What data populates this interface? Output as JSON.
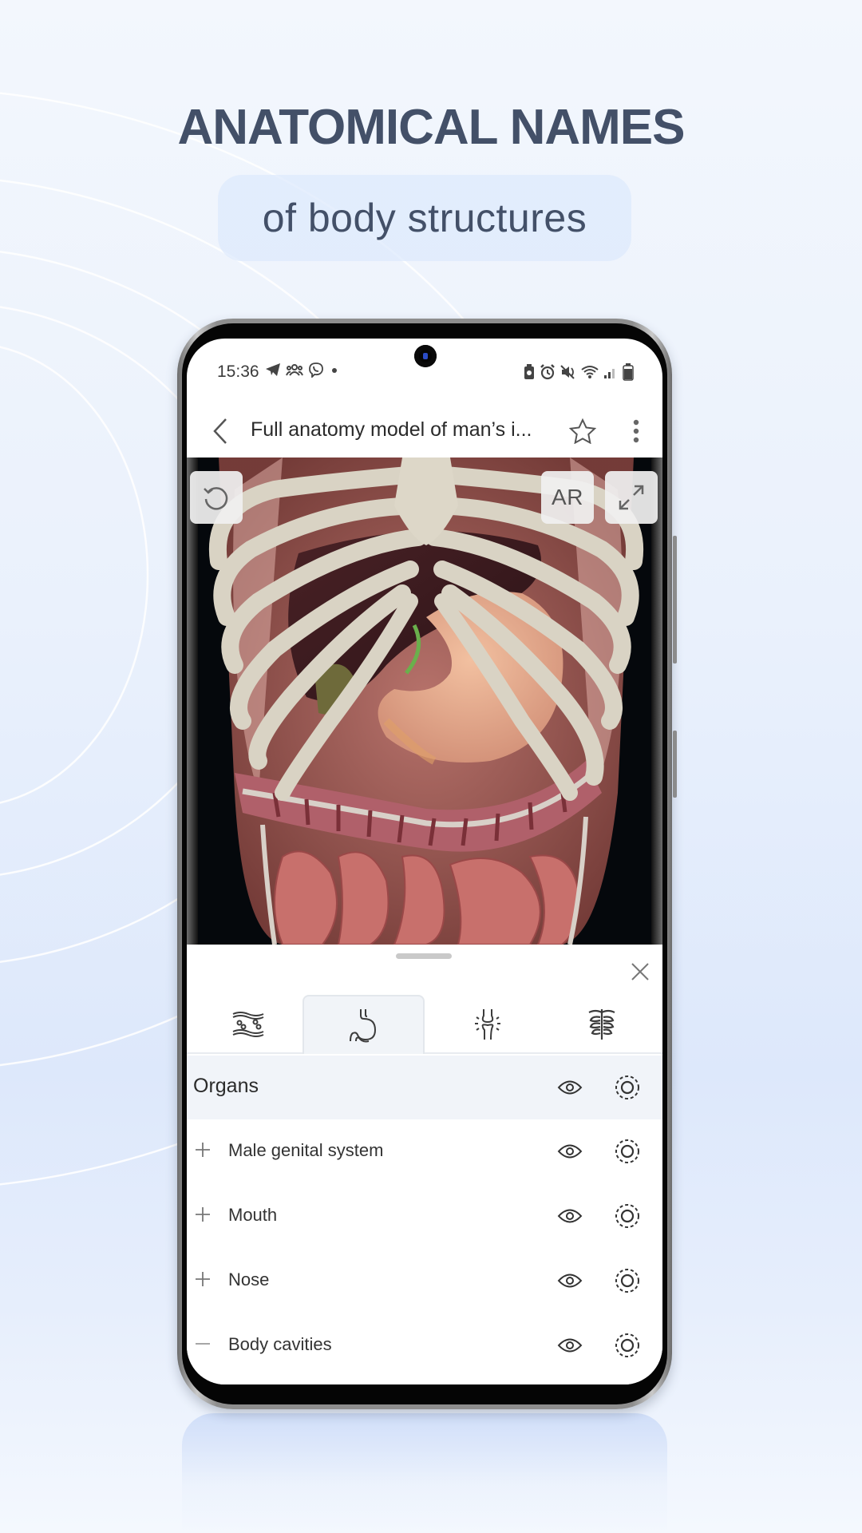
{
  "promo": {
    "headline": "ANATOMICAL NAMES",
    "subtitle": "of body structures"
  },
  "status_bar": {
    "time": "15:36",
    "left_icons": [
      "telegram-icon",
      "group-icon",
      "viber-icon",
      "dot-icon"
    ],
    "right_icons": [
      "battery-saver-icon",
      "alarm-icon",
      "mute-icon",
      "wifi-icon",
      "signal-icon",
      "battery-icon"
    ]
  },
  "app_bar": {
    "title": "Full anatomy model of man’s i...",
    "back_icon": "chevron-left-icon",
    "favorite_icon": "star-outline-icon",
    "menu_icon": "more-vertical-icon"
  },
  "viewer": {
    "reset_icon": "rotate-ccw-icon",
    "ar_label": "AR",
    "fullscreen_icon": "expand-icon"
  },
  "sheet": {
    "close_icon": "close-icon",
    "tabs": [
      {
        "name": "vessels",
        "icon": "blood-vessel-icon",
        "active": false
      },
      {
        "name": "organs",
        "icon": "stomach-icon",
        "active": true
      },
      {
        "name": "joints",
        "icon": "joint-icon",
        "active": false
      },
      {
        "name": "skeleton",
        "icon": "ribcage-icon",
        "active": false
      }
    ],
    "section_title": "Organs",
    "items": [
      {
        "label": "Male genital system",
        "toggle": "+"
      },
      {
        "label": "Mouth",
        "toggle": "+"
      },
      {
        "label": "Nose",
        "toggle": "+"
      },
      {
        "label": "Body cavities",
        "toggle": "—"
      }
    ]
  },
  "colors": {
    "headline": "#435068",
    "background_top": "#f3f7fd",
    "background_mid": "#dde8fb",
    "section_header_bg": "#f1f4f9",
    "active_tab_bg": "#f1f4f8"
  }
}
